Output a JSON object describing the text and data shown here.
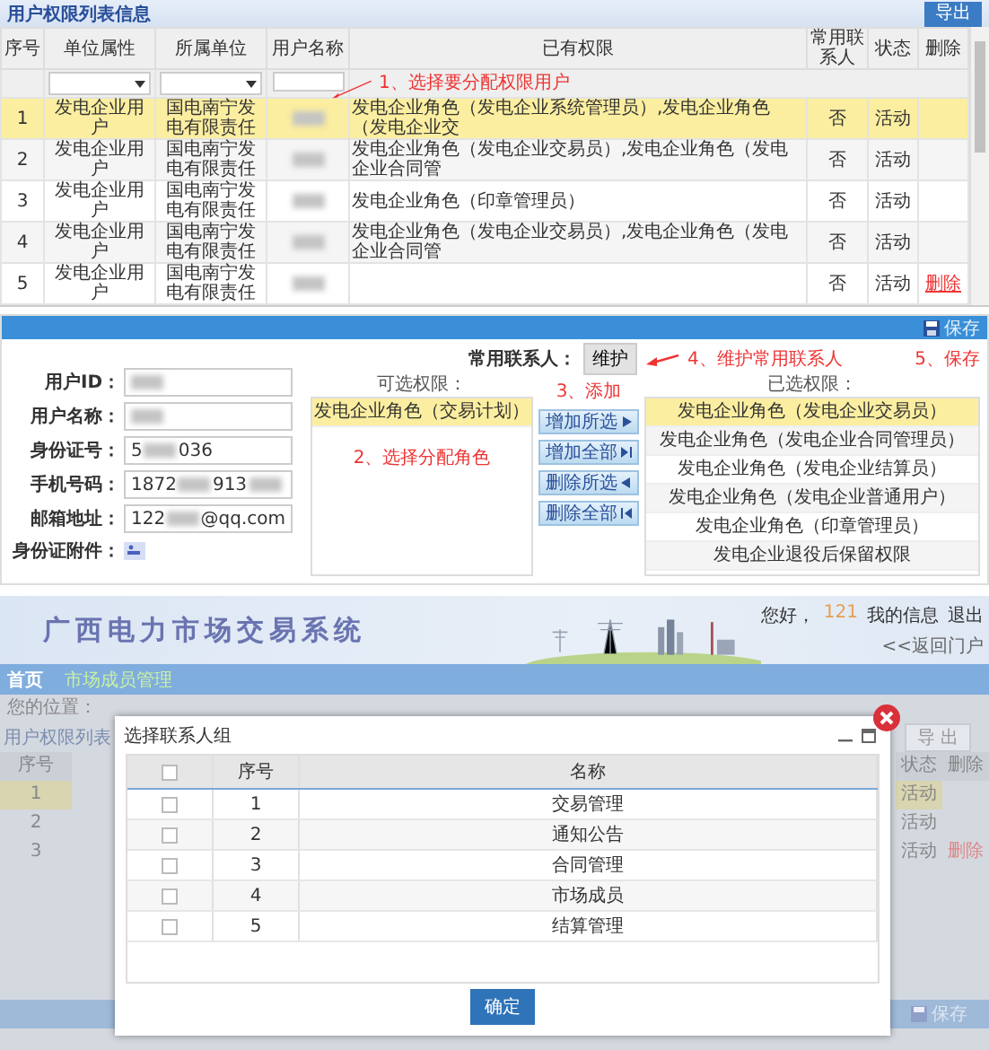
{
  "list_panel": {
    "title": "用户权限列表信息",
    "export_button": "导出",
    "columns": [
      "序号",
      "单位属性",
      "所属单位",
      "用户名称",
      "已有权限",
      "常用联系人",
      "状态",
      "删除"
    ],
    "filters": [
      {
        "kind": "select"
      },
      {
        "kind": "select"
      },
      {
        "kind": "text"
      }
    ],
    "annotation": "1、选择要分配权限用户",
    "rows": [
      {
        "index": "1",
        "unit_type": "发电企业用户",
        "unit": "国电南宁发电有限责任",
        "permissions": "发电企业角色（发电企业系统管理员）,发电企业角色（发电企业交",
        "contact": "否",
        "status": "活动",
        "selected": true
      },
      {
        "index": "2",
        "unit_type": "发电企业用户",
        "unit": "国电南宁发电有限责任",
        "permissions": "发电企业角色（发电企业交易员）,发电企业角色（发电企业合同管",
        "contact": "否",
        "status": "活动",
        "selected": false
      },
      {
        "index": "3",
        "unit_type": "发电企业用户",
        "unit": "国电南宁发电有限责任",
        "permissions": "发电企业角色（印章管理员）",
        "contact": "否",
        "status": "活动",
        "selected": false
      },
      {
        "index": "4",
        "unit_type": "发电企业用户",
        "unit": "国电南宁发电有限责任",
        "permissions": "发电企业角色（发电企业交易员）,发电企业角色（发电企业合同管",
        "contact": "否",
        "status": "活动",
        "selected": false
      },
      {
        "index": "5",
        "unit_type": "发电企业用户",
        "unit": "国电南宁发电有限责任",
        "contact": "否",
        "status": "活动",
        "delete_link": "删除",
        "selected": false
      }
    ]
  },
  "edit_panel": {
    "save_button": "保存",
    "save_annotation": "5、保存",
    "fields": [
      {
        "label": "用户ID：",
        "parts": [
          {
            "kind": "blur"
          }
        ]
      },
      {
        "label": "用户名称：",
        "parts": [
          {
            "kind": "blur"
          }
        ]
      },
      {
        "label": "身份证号：",
        "parts": [
          {
            "kind": "text",
            "text": "5"
          },
          {
            "kind": "blur"
          },
          {
            "kind": "text",
            "text": "036"
          }
        ]
      },
      {
        "label": "手机号码：",
        "parts": [
          {
            "kind": "text",
            "text": "1872"
          },
          {
            "kind": "blur"
          },
          {
            "kind": "text",
            "text": "913"
          },
          {
            "kind": "blur"
          }
        ]
      },
      {
        "label": "邮箱地址：",
        "parts": [
          {
            "kind": "text",
            "text": "122"
          },
          {
            "kind": "blur"
          },
          {
            "kind": "text",
            "text": "@qq.com"
          }
        ]
      }
    ],
    "attachment_label": "身份证附件：",
    "contact_label": "常用联系人：",
    "maintain_button": "维护",
    "maintain_annotation": "4、维护常用联系人",
    "available_label": "可选权限：",
    "available": [
      {
        "label": "发电企业角色（交易计划）",
        "selected": true
      }
    ],
    "available_annotation": "2、选择分配角色",
    "add_annotation": "3、添加",
    "move_buttons": [
      {
        "label": "增加所选",
        "kind": "add-one"
      },
      {
        "label": "增加全部",
        "kind": "add-all"
      },
      {
        "label": "删除所选",
        "kind": "remove-one"
      },
      {
        "label": "删除全部",
        "kind": "remove-all"
      }
    ],
    "chosen_label": "已选权限：",
    "chosen": [
      {
        "label": "发电企业角色（发电企业交易员）",
        "selected": true
      },
      {
        "label": "发电企业角色（发电企业合同管理员）",
        "selected": false
      },
      {
        "label": "发电企业角色（发电企业结算员）",
        "selected": false
      },
      {
        "label": "发电企业角色（发电企业普通用户）",
        "selected": false
      },
      {
        "label": "发电企业角色（印章管理员）",
        "selected": false
      },
      {
        "label": "发电企业退役后保留权限",
        "selected": false
      }
    ]
  },
  "portal": {
    "title": "广西电力市场交易系统",
    "greeting": "您好，",
    "user": "121",
    "my_info": "我的信息",
    "logout": "退出",
    "back": "<<返回门户",
    "nav": [
      "首页",
      "市场成员管理"
    ],
    "breadcrumb_label": "您的位置：",
    "list_title": "用户权限列表",
    "export_button": "导 出",
    "columns": [
      "序号",
      "状态",
      "删除"
    ],
    "rows": [
      {
        "index": "1",
        "status": "活动",
        "selected": true
      },
      {
        "index": "2",
        "status": "活动",
        "selected": false
      },
      {
        "index": "3",
        "status": "活动",
        "delete_link": "删除",
        "selected": false
      }
    ],
    "save_button": "保存"
  },
  "modal": {
    "title": "选择联系人组",
    "all_checked": false,
    "columns": [
      "序号",
      "名称"
    ],
    "rows": [
      {
        "index": "1",
        "name": "交易管理",
        "checked": false
      },
      {
        "index": "2",
        "name": "通知公告",
        "checked": false
      },
      {
        "index": "3",
        "name": "合同管理",
        "checked": false
      },
      {
        "index": "4",
        "name": "市场成员",
        "checked": false
      },
      {
        "index": "5",
        "name": "结算管理",
        "checked": false
      }
    ],
    "ok_button": "确定"
  }
}
